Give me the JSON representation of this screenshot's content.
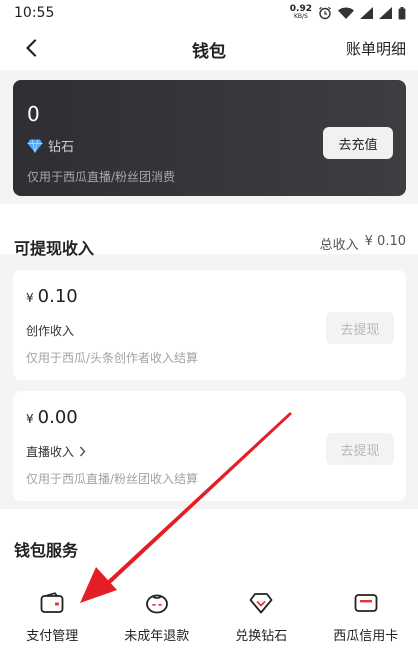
{
  "status_bar": {
    "time": "10:55",
    "net_speed_value": "0.92",
    "net_speed_unit": "KB/S"
  },
  "nav": {
    "title": "钱包",
    "right_link": "账单明细"
  },
  "diamond_card": {
    "count": "0",
    "label": "钻石",
    "note": "仅用于西瓜直播/粉丝团消费",
    "recharge_label": "去充值"
  },
  "withdrawable": {
    "title": "可提现收入",
    "total_label": "总收入",
    "total_value": "¥ 0.10"
  },
  "income_cards": [
    {
      "currency": "¥",
      "amount": "0.10",
      "name": "创作收入",
      "note": "仅用于西瓜/头条创作者收入结算",
      "withdraw_label": "去提现"
    },
    {
      "currency": "¥",
      "amount": "0.00",
      "name": "直播收入",
      "note": "仅用于西瓜直播/粉丝团收入结算",
      "withdraw_label": "去提现"
    }
  ],
  "services": {
    "title": "钱包服务",
    "items": [
      {
        "label": "支付管理",
        "icon": "wallet-icon"
      },
      {
        "label": "未成年退款",
        "icon": "child-face-icon"
      },
      {
        "label": "兑换钻石",
        "icon": "diamond-icon"
      },
      {
        "label": "西瓜信用卡",
        "icon": "credit-card-icon"
      }
    ]
  },
  "colors": {
    "card_dark": "#333337",
    "diamond_blue": "#4aa8ff",
    "accent_red": "#e8343a",
    "disabled_text": "#b8b8b8"
  }
}
